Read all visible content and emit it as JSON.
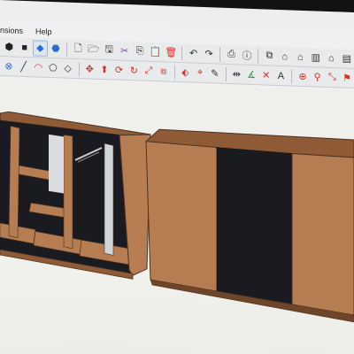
{
  "menubar": {
    "items": [
      "nsions",
      "Help"
    ]
  },
  "toolbar1": {
    "icons": [
      "components-icon",
      "solid-tools-icon",
      "extension-warehouse-icon",
      "extension-manager-icon",
      "new-icon",
      "open-icon",
      "save-icon",
      "cut-icon",
      "copy-icon",
      "paste-icon",
      "erase-icon",
      "undo-icon",
      "redo-icon",
      "print-icon",
      "model-info-icon",
      "iso-view-icon",
      "top-view-icon",
      "front-view-icon",
      "right-view-icon",
      "back-view-icon",
      "left-view-icon"
    ],
    "active": "solid-tools-icon"
  },
  "toolbar2": {
    "icons": [
      "orbit-icon",
      "line-icon",
      "arc-icon",
      "polygon-icon",
      "rotated-rect-icon",
      "move-icon",
      "push-pull-icon",
      "rotate-icon",
      "follow-me-icon",
      "scale-icon",
      "offset-icon",
      "paint-icon",
      "tape-measure-icon",
      "eraser-icon",
      "dimension-icon",
      "protractor-icon",
      "axes-icon",
      "text-icon",
      "section-plane-icon",
      "zoom-icon",
      "zoom-extents-icon",
      "walk-icon"
    ]
  },
  "colors": {
    "wood": "#b77d52",
    "wood_dark": "#8f5a36",
    "panel_black": "#1a1b20",
    "edge": "#4a3222"
  }
}
